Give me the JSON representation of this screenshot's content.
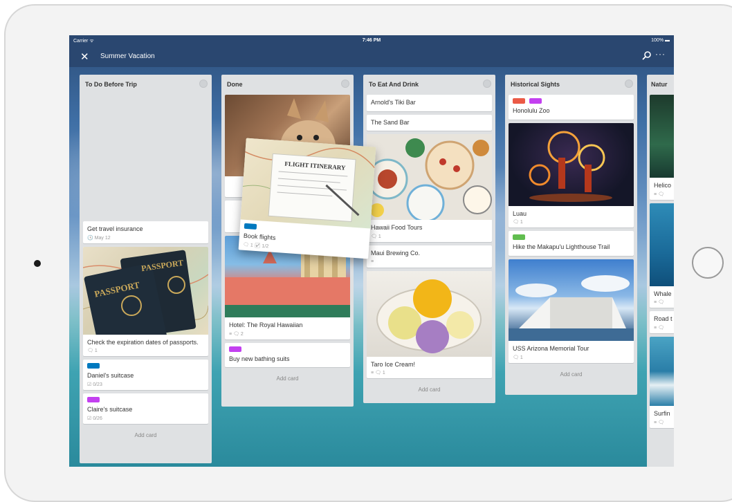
{
  "status": {
    "carrier": "Carrier ᯤ",
    "time": "7:46 PM",
    "battery": "100% ▬"
  },
  "board": {
    "title": "Summer Vacation"
  },
  "icons": {
    "close": "close-icon",
    "search": "search-icon",
    "more": "more-icon"
  },
  "lists": [
    {
      "title": "To Do Before Trip",
      "cards": [
        {
          "text": "Get travel insurance",
          "meta": "🕓 May 12"
        },
        {
          "text": "Check the expiration dates of passports.",
          "meta": "🗨 1"
        },
        {
          "text": "Daniel's suitcase",
          "meta": "☑ 0/23"
        },
        {
          "text": "Claire's suitcase",
          "meta": "☑ 0/26"
        }
      ],
      "add": "Add card"
    },
    {
      "title": "Done",
      "cards": [
        {
          "text": "Hotel: The Royal Hawaiian",
          "meta": "≡ 🗨 2"
        },
        {
          "text": "Buy new bathing suits",
          "meta": ""
        }
      ],
      "add": "Add card"
    },
    {
      "title": "To Eat And Drink",
      "cards": [
        {
          "text": "Arnold's Tiki Bar"
        },
        {
          "text": "The Sand Bar"
        },
        {
          "text": "Hawaii Food Tours",
          "meta": "🗨 1"
        },
        {
          "text": "Maui Brewing Co.",
          "meta": "≡"
        },
        {
          "text": "Taro Ice Cream!",
          "meta": "≡ 🗨 1"
        }
      ],
      "add": "Add card"
    },
    {
      "title": "Historical Sights",
      "cards": [
        {
          "text": "Honolulu Zoo"
        },
        {
          "text": "Luau",
          "meta": "🗨 1"
        },
        {
          "text": "Hike the Makapu'u Lighthouse Trail"
        },
        {
          "text": "USS Arizona Memorial Tour",
          "meta": "🗨 1"
        }
      ],
      "add": "Add card"
    },
    {
      "title": "Natur",
      "cards": [
        {
          "text": "Helico"
        },
        {
          "text": "Whale"
        },
        {
          "text": "Road t"
        },
        {
          "text": "Surfin"
        }
      ]
    }
  ],
  "drag_card": {
    "text": "Book flights",
    "meta": "🗨 1  ☑ 1/2",
    "ticket_text": "FLIGHT ITINERARY"
  },
  "passport_text": "PASSPORT",
  "colors": {
    "blue": "#0079bf",
    "purple": "#c340f0",
    "red": "#eb5a46",
    "green": "#61bd4f"
  }
}
